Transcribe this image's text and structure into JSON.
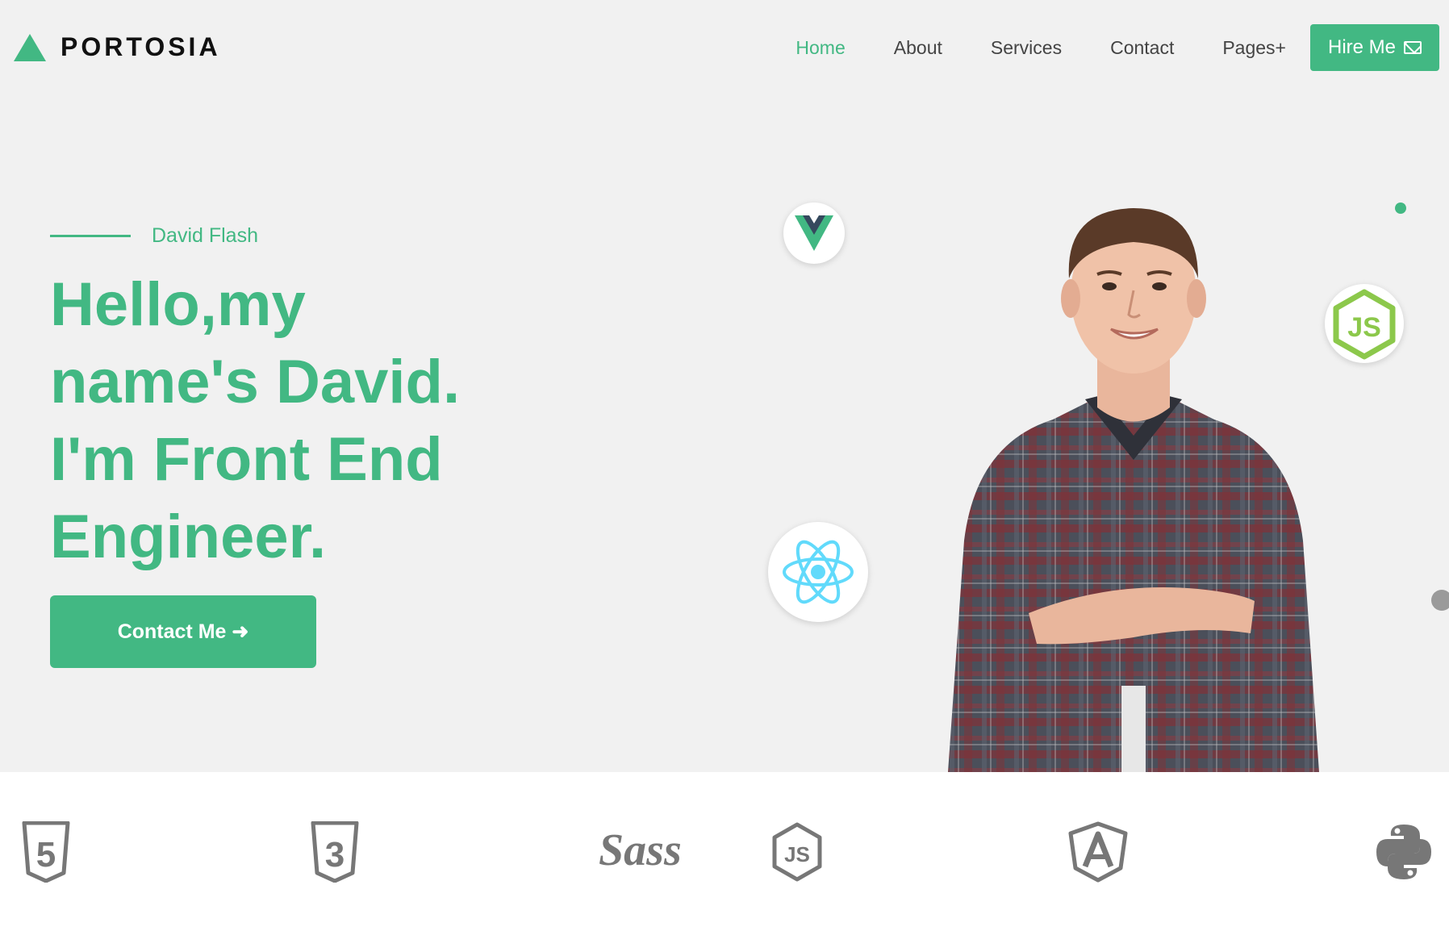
{
  "header": {
    "brand": "PORTOSIA",
    "nav": [
      "Home",
      "About",
      "Services",
      "Contact",
      "Pages+"
    ],
    "active_nav": "Home",
    "cta_label": "Hire Me"
  },
  "hero": {
    "eyebrow": "David Flash",
    "headline_lines": [
      "Hello,my",
      "name's David.",
      "I'm Front End",
      "Engineer."
    ],
    "button_label": "Contact Me ➜"
  },
  "floating_icons": [
    "vue-icon",
    "react-icon",
    "nodejs-icon"
  ],
  "tech_strip": [
    "html5-icon",
    "css3-icon",
    "sass-icon",
    "nodejs-icon",
    "angular-icon",
    "python-icon"
  ],
  "colors": {
    "accent": "#42b883",
    "background": "#f1f1f1",
    "strip_background": "#ffffff",
    "icon_gray": "#666666"
  }
}
